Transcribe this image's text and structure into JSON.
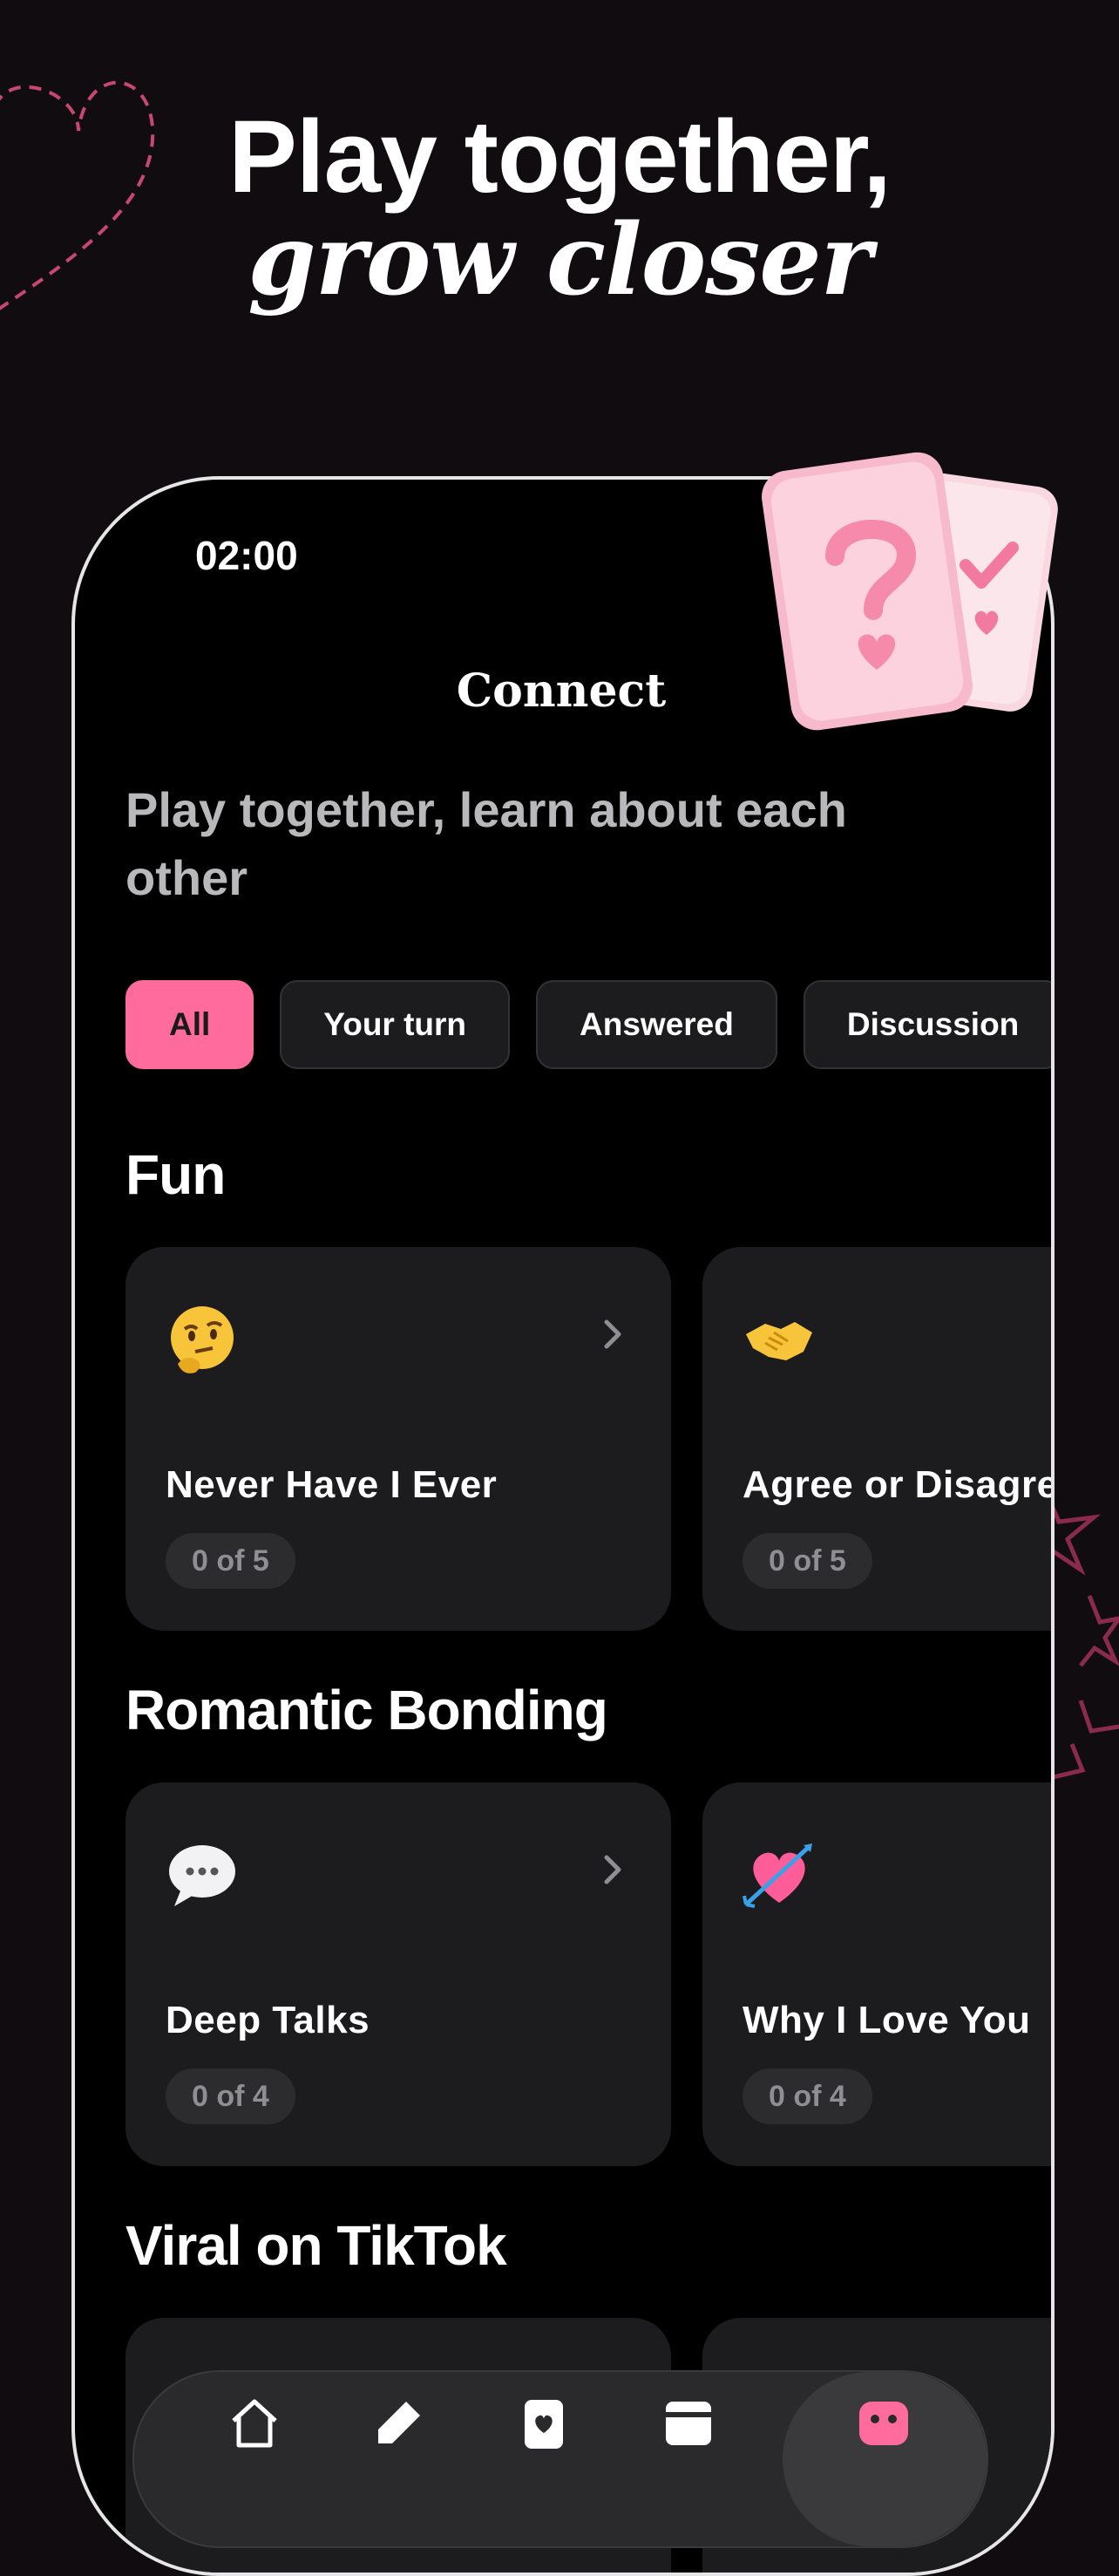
{
  "headline": {
    "line1": "Play together,",
    "line2": "grow closer"
  },
  "status": {
    "time": "02:00"
  },
  "nav": {
    "title": "Connect"
  },
  "subtitle": "Play together, learn about each other",
  "filters": [
    "All",
    "Your turn",
    "Answered",
    "Discussion"
  ],
  "sections": [
    {
      "title": "Fun",
      "cards": [
        {
          "icon": "thinking-face-emoji",
          "title": "Never Have I Ever",
          "progress": "0 of 5"
        },
        {
          "icon": "handshake-emoji",
          "title": "Agree or Disagree",
          "progress": "0 of 5"
        }
      ]
    },
    {
      "title": "Romantic Bonding",
      "cards": [
        {
          "icon": "speech-bubble-emoji",
          "title": "Deep Talks",
          "progress": "0 of 4"
        },
        {
          "icon": "heart-with-arrow-emoji",
          "title": "Why I Love You",
          "progress": "0 of 4"
        }
      ]
    },
    {
      "title": "Viral on TikTok",
      "cards": []
    }
  ],
  "tabbar": {
    "items": [
      "home-icon",
      "pen-icon",
      "cards-icon",
      "calendar-icon",
      "connect-icon"
    ],
    "active_color": "#ff6b9d"
  },
  "colors": {
    "accent": "#ff6b9d",
    "background": "#100c10",
    "card": "#1c1c1e"
  }
}
